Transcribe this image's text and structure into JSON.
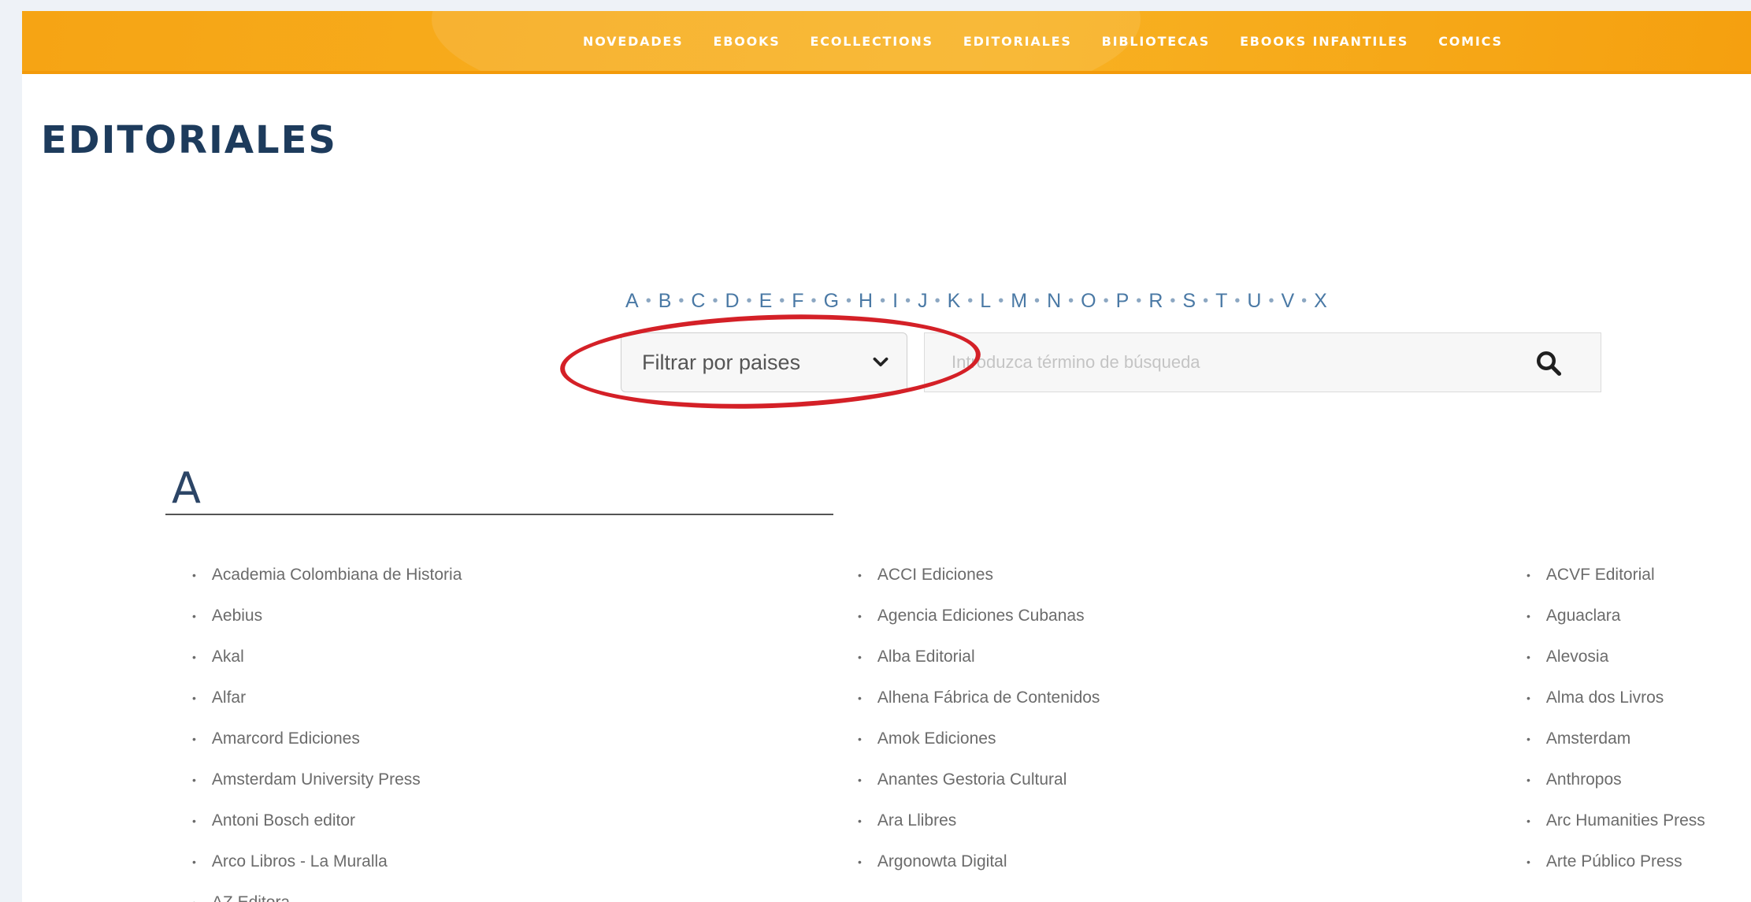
{
  "nav": {
    "items": [
      "NOVEDADES",
      "EBOOKS",
      "ECOLLECTIONS",
      "EDITORIALES",
      "BIBLIOTECAS",
      "EBOOKS INFANTILES",
      "COMICS"
    ]
  },
  "page": {
    "title": "EDITORIALES"
  },
  "alphabet": [
    "A",
    "B",
    "C",
    "D",
    "E",
    "F",
    "G",
    "H",
    "I",
    "J",
    "K",
    "L",
    "M",
    "N",
    "O",
    "P",
    "R",
    "S",
    "T",
    "U",
    "V",
    "X"
  ],
  "filters": {
    "country_select_label": "Filtrar por paises",
    "search_placeholder": "Introduzca término de búsqueda"
  },
  "section": {
    "letter": "A",
    "columns": [
      [
        "Academia Colombiana de Historia",
        "Aebius",
        "Akal",
        "Alfar",
        "Amarcord Ediciones",
        "Amsterdam University Press",
        "Antoni Bosch editor",
        "Arco Libros - La Muralla",
        "AZ Editora"
      ],
      [
        "ACCI Ediciones",
        "Agencia Ediciones Cubanas",
        "Alba Editorial",
        "Alhena Fábrica de Contenidos",
        "Amok Ediciones",
        "Anantes Gestoria Cultural",
        "Ara Llibres",
        "Argonowta Digital"
      ],
      [
        "ACVF Editorial",
        "Aguaclara",
        "Alevosia",
        "Alma dos Livros",
        "Amsterdam",
        "Anthropos",
        "Arc Humanities Press",
        "Arte Público Press"
      ]
    ]
  },
  "colors": {
    "nav_orange": "#f6a414",
    "title_navy": "#1d3b5c",
    "link_blue": "#4a79a5",
    "highlight_red": "#d42027"
  },
  "icons": {
    "select": "chevron-down-icon",
    "search": "search-icon"
  }
}
